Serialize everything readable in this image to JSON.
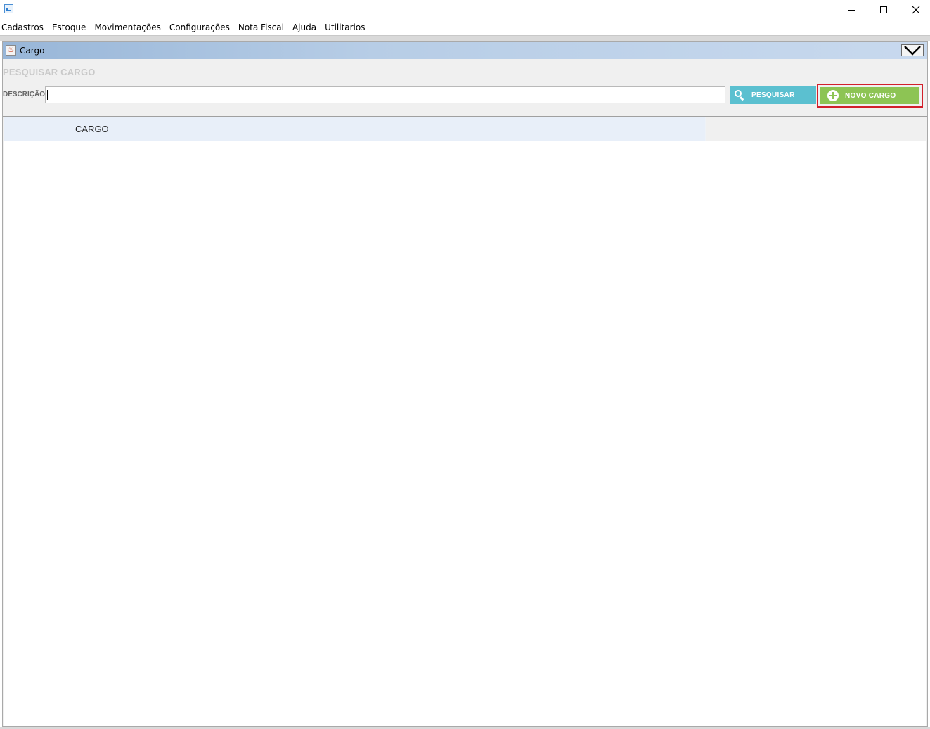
{
  "window": {
    "icon": "app-chart-icon",
    "controls": {
      "minimize": "minimize-icon",
      "maximize": "maximize-icon",
      "close": "close-icon"
    }
  },
  "menu": {
    "items": [
      "Cadastros",
      "Estoque",
      "Movimentações",
      "Configurações",
      "Nota Fiscal",
      "Ajuda",
      "Utilitarios"
    ]
  },
  "frame": {
    "title": "Cargo",
    "icon": "java-cup-icon",
    "collapse_icon": "chevron-down-icon"
  },
  "search": {
    "section_title": "PESQUISAR CARGO",
    "description_label": "DESCRIÇÃO",
    "description_value": "",
    "search_button_label": "PESQUISAR",
    "new_button_label": "NOVO CARGO"
  },
  "table": {
    "columns": [
      "CARGO"
    ],
    "rows": []
  },
  "colors": {
    "search_button": "#5bc0d0",
    "new_button": "#8dc454",
    "highlight_border": "#d21f2b",
    "frame_title_gradient_start": "#98b6d8"
  }
}
